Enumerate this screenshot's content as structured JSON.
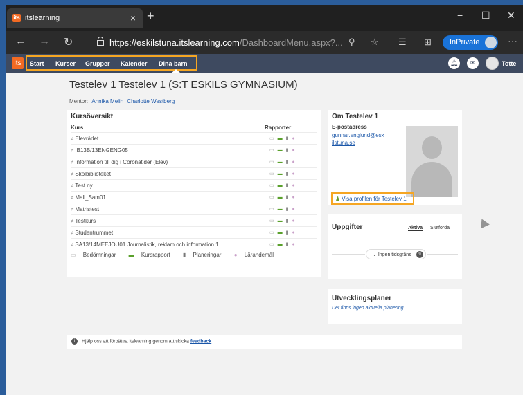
{
  "browser": {
    "tab_title": "itslearning",
    "favicon_text": "its",
    "new_tab": "+",
    "url_host": "https://eskilstuna.itslearning.com",
    "url_path": "/DashboardMenu.aspx?...",
    "inprivate": "InPrivate",
    "window_buttons": [
      "−",
      "☐",
      "✕"
    ],
    "more": "···"
  },
  "site": {
    "logo": "its",
    "nav_items": [
      "Start",
      "Kurser",
      "Grupper",
      "Kalender",
      "Dina barn"
    ],
    "username": "Totte"
  },
  "page": {
    "title": "Testelev 1 Testelev 1 (S:T ESKILS GYMNASIUM)",
    "mentor_label": "Mentor:",
    "mentors": [
      "Annika Melin",
      "Charlotte Westberg"
    ]
  },
  "courses": {
    "heading": "Kursöversikt",
    "col_course": "Kurs",
    "col_reports": "Rapporter",
    "items": [
      "Elevrådet",
      "IB13B/13ENGENG05",
      "Information till dig i Coronatider (Elev)",
      "Skolbiblioteket",
      "Test ny",
      "Mall_Sam01",
      "Matristest",
      "Testkurs",
      "Studentrummet",
      "SA13/14MEEJOU01 Journalistik, reklam och information 1"
    ],
    "legend": [
      "Bedömningar",
      "Kursrapport",
      "Planeringar",
      "Lärandemål"
    ]
  },
  "profile": {
    "heading": "Om Testelev 1",
    "email_label": "E-postadress",
    "email_line1": "gunnar.englund@esk",
    "email_line2": "ilstuna.se",
    "profile_link": "Visa profilen för Testelev 1"
  },
  "tasks": {
    "heading": "Uppgifter",
    "tab_active": "Aktiva",
    "tab_done": "Slutförda",
    "filter": "Ingen tidsgräns",
    "count": "9"
  },
  "plans": {
    "heading": "Utvecklingsplaner",
    "empty": "Det finns ingen aktuella planering."
  },
  "feedback": {
    "text": "Hjälp oss att förbättra itslearning genom att skicka",
    "link": "feedback"
  },
  "colors": {
    "nav_bg": "#3e4a60",
    "accent_orange": "#f26a23",
    "highlight": "#f5a623",
    "link": "#1a56a8"
  }
}
